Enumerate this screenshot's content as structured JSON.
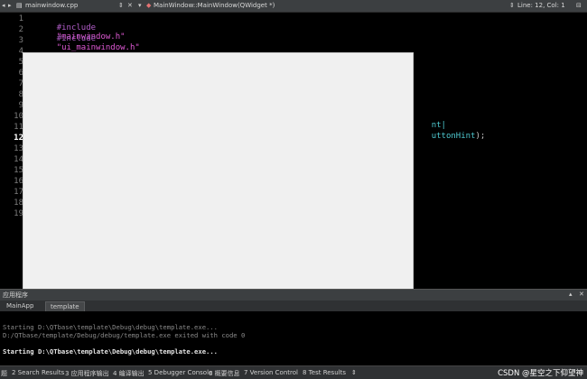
{
  "topbar": {
    "file_name": "mainwindow.cpp",
    "function_path": "MainWindow::MainWindow(QWidget *)",
    "position": "Line: 12, Col: 1"
  },
  "editor": {
    "line_numbers": [
      "1",
      "2",
      "3",
      "4",
      "5",
      "6",
      "7",
      "8",
      "9",
      "10",
      "11",
      "12",
      "13",
      "14",
      "15",
      "16",
      "17",
      "18",
      "19"
    ],
    "current_line": "12",
    "line1": {
      "directive": "#include",
      "target": "\"mainwindow.h\""
    },
    "line2": {
      "directive": "#include",
      "target": "\"ui_mainwindow.h\""
    },
    "line10_tail": "nt|",
    "line11_tail_name": "uttonHint",
    "line11_tail_end": ");"
  },
  "panel": {
    "header_label": "应用程序",
    "tabs": [
      "MainApp",
      "template"
    ],
    "output_lines": [
      "Starting D:\\QTbase\\template\\Debug\\debug\\template.exe...",
      "D:/QTbase/template/Debug/debug/template.exe exited with code 0",
      "Starting D:\\QTbase\\template\\Debug\\debug\\template.exe..."
    ]
  },
  "statusbar": {
    "items": [
      "题",
      "2 Search Results",
      "3 应用程序输出",
      "4 编译输出",
      "5 Debugger Console",
      "6 概要信息",
      "7 Version Control",
      "8 Test Results",
      "⇕"
    ],
    "watermark": "CSDN @星空之下仰望神"
  }
}
